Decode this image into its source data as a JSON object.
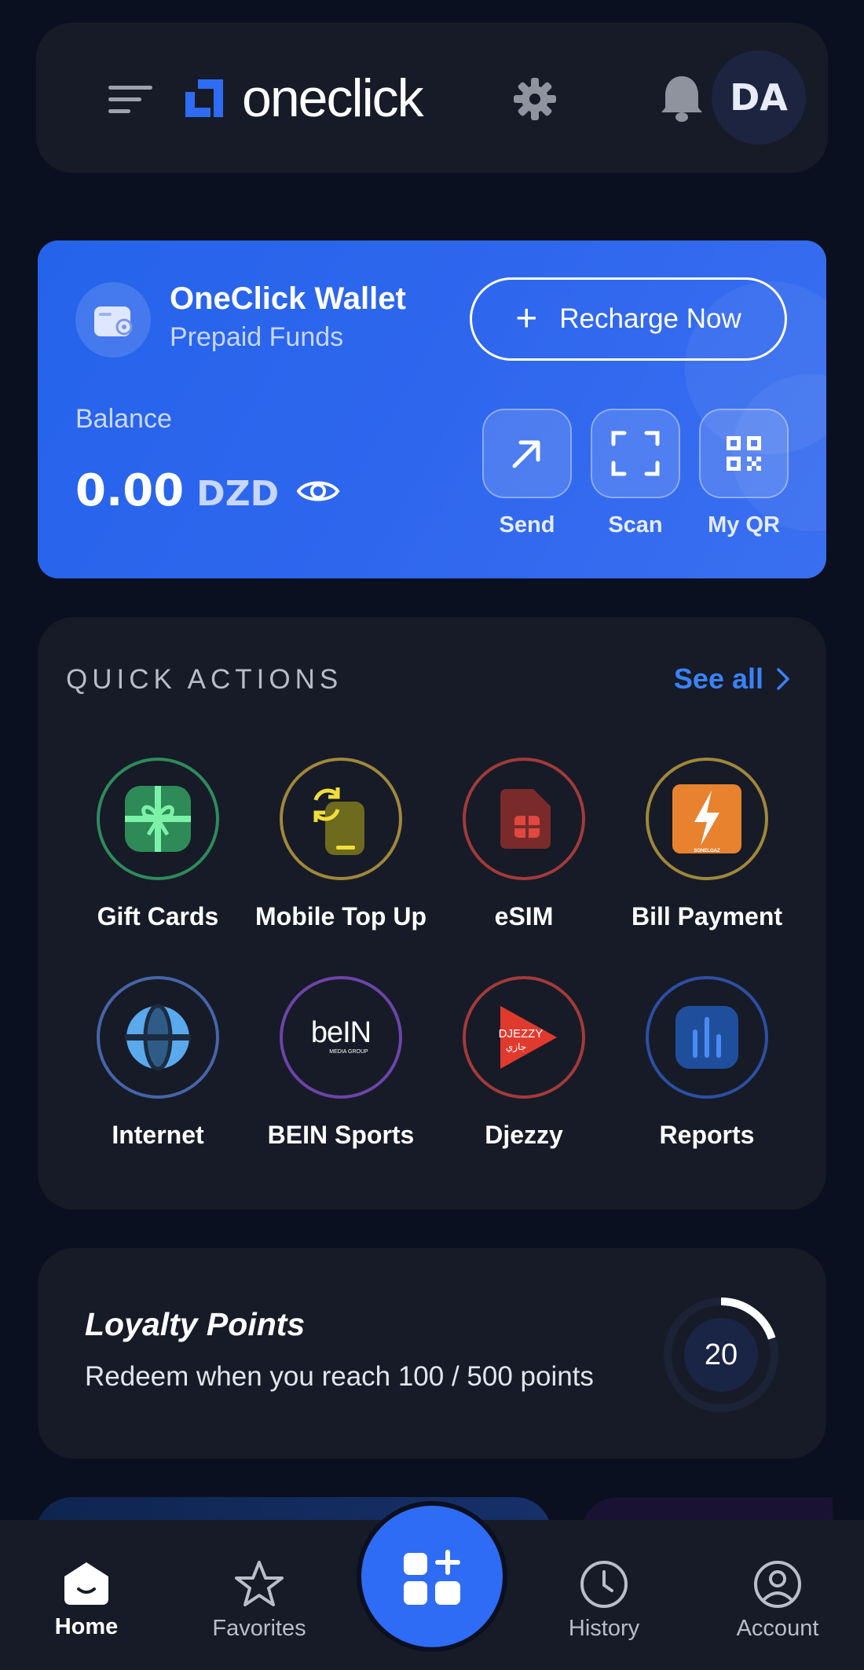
{
  "header": {
    "logo_text": "oneclick",
    "avatar_initials": "DA"
  },
  "wallet": {
    "title": "OneClick Wallet",
    "subtitle": "Prepaid Funds",
    "recharge_label": "Recharge Now",
    "balance_label": "Balance",
    "balance_amount": "0.00",
    "balance_currency": "DZD",
    "actions": [
      {
        "label": "Send",
        "icon": "arrow-up-right-icon"
      },
      {
        "label": "Scan",
        "icon": "scan-frame-icon"
      },
      {
        "label": "My QR",
        "icon": "qr-code-icon"
      }
    ],
    "accent_color": "#2563eb"
  },
  "quick_actions": {
    "title": "QUICK ACTIONS",
    "see_all_label": "See all",
    "items": [
      {
        "label": "Gift Cards",
        "icon": "gift-card-icon",
        "ring_color": "#2f8a5b"
      },
      {
        "label": "Mobile Top Up",
        "icon": "mobile-topup-icon",
        "ring_color": "#a0873a"
      },
      {
        "label": "eSIM",
        "icon": "esim-icon",
        "ring_color": "#a23a3a"
      },
      {
        "label": "Bill Payment",
        "icon": "bill-payment-icon",
        "ring_color": "#a0873a",
        "logo_caption": "SONELGAZ"
      },
      {
        "label": "Internet",
        "icon": "globe-icon",
        "ring_color": "#4665a8"
      },
      {
        "label": "BEIN Sports",
        "icon": "bein-logo-icon",
        "ring_color": "#6d44a8",
        "logo_text": "beIN",
        "logo_caption": "MEDIA GROUP"
      },
      {
        "label": "Djezzy",
        "icon": "djezzy-logo-icon",
        "ring_color": "#a33a3a",
        "logo_text": "DJEZZY",
        "logo_caption": "جازي"
      },
      {
        "label": "Reports",
        "icon": "reports-chart-icon",
        "ring_color": "#2d4fa3"
      }
    ]
  },
  "loyalty": {
    "title": "Loyalty Points",
    "subtitle": "Redeem when you reach 100 / 500 points",
    "points": "20",
    "progress_fraction": 0.2
  },
  "nav": {
    "items": [
      {
        "label": "Home",
        "icon": "home-icon",
        "active": true
      },
      {
        "label": "Favorites",
        "icon": "star-icon",
        "active": false
      },
      {
        "label": "History",
        "icon": "clock-icon",
        "active": false
      },
      {
        "label": "Account",
        "icon": "account-icon",
        "active": false
      }
    ],
    "fab_icon": "add-widget-icon"
  }
}
